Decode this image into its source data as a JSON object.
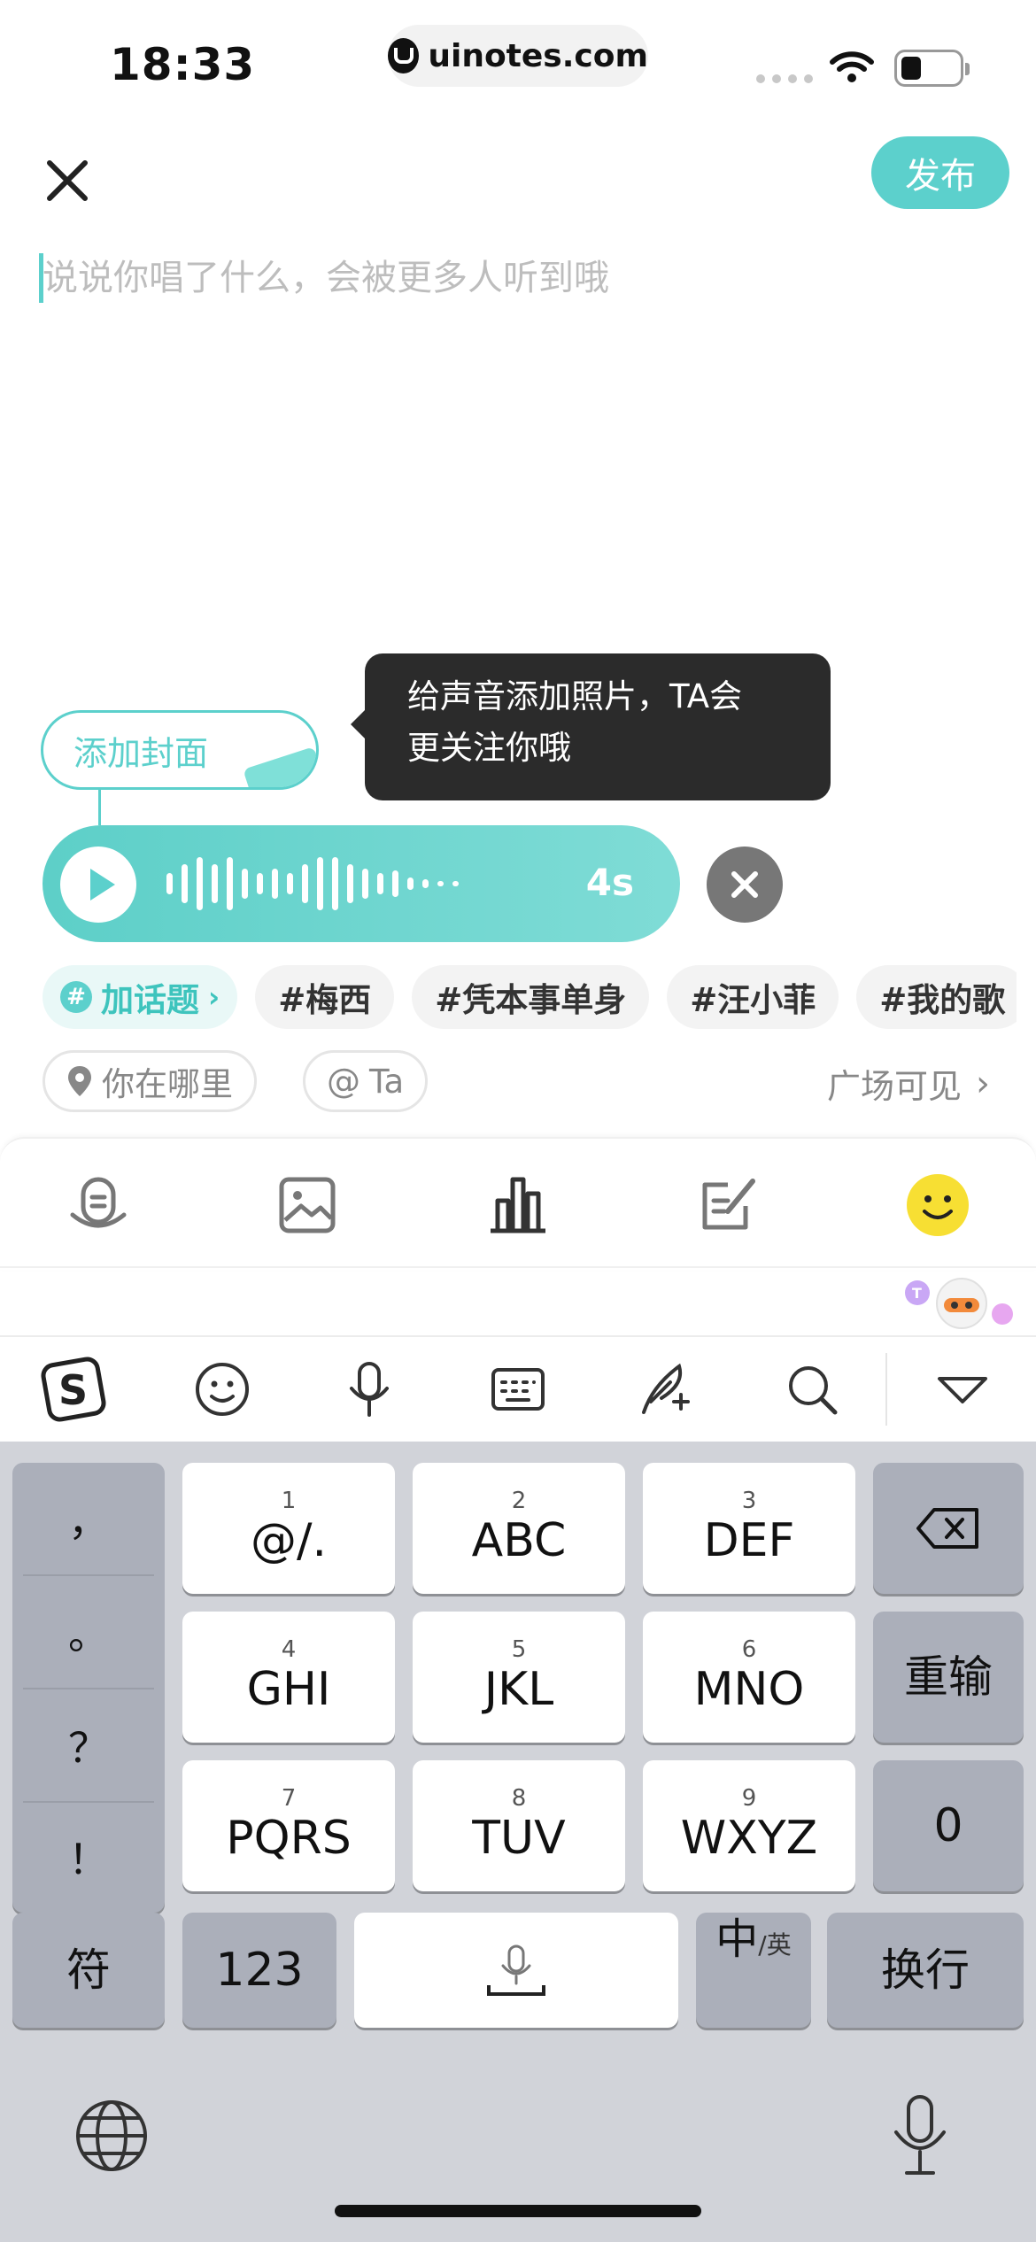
{
  "status_bar": {
    "time": "18:33",
    "url": "uinotes.com"
  },
  "header": {
    "publish_label": "发布"
  },
  "composer": {
    "placeholder": "说说你唱了什么，会被更多人听到哦"
  },
  "tooltip": {
    "line1": "给声音添加照片，TA会",
    "line2": "更关注你哦"
  },
  "cover": {
    "label": "添加封面"
  },
  "voice": {
    "duration": "4s"
  },
  "topics": {
    "add_label": "加话题",
    "items": [
      "#梅西",
      "#凭本事单身",
      "#汪小菲",
      "#我的歌"
    ]
  },
  "meta_row": {
    "location": "你在哪里",
    "mention": "Ta",
    "visibility": "广场可见"
  },
  "toolbar": {
    "icons": [
      "voice-icon",
      "image-icon",
      "chart-icon",
      "edit-icon",
      "emoji-icon"
    ]
  },
  "ime_bar": {
    "icons": [
      "sogou-logo-icon",
      "emoji-icon",
      "microphone-icon",
      "keyboard-icon",
      "handwriting-icon",
      "search-icon",
      "collapse-icon"
    ]
  },
  "keyboard": {
    "punct": [
      "，",
      "。",
      "？",
      "！"
    ],
    "keys": [
      {
        "num": "1",
        "label": "@/."
      },
      {
        "num": "2",
        "label": "ABC"
      },
      {
        "num": "3",
        "label": "DEF"
      },
      {
        "num": "4",
        "label": "GHI"
      },
      {
        "num": "5",
        "label": "JKL"
      },
      {
        "num": "6",
        "label": "MNO"
      },
      {
        "num": "7",
        "label": "PQRS"
      },
      {
        "num": "8",
        "label": "TUV"
      },
      {
        "num": "9",
        "label": "WXYZ"
      }
    ],
    "reinput": "重输",
    "zero": "0",
    "symbols": "符",
    "num123": "123",
    "zh": "中",
    "en": "/英",
    "newline": "换行"
  }
}
